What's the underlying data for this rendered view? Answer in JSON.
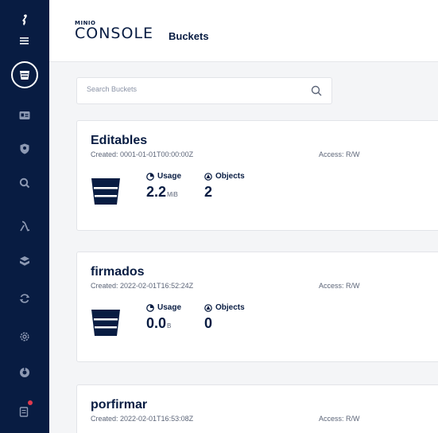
{
  "app": {
    "brand_top": "MINIO",
    "brand_main": "CONSOLE",
    "page_title": "Buckets"
  },
  "search": {
    "placeholder": "Search Buckets"
  },
  "sidebar": {
    "items": [
      {
        "icon": "menu-icon"
      },
      {
        "icon": "bucket-icon",
        "active": true
      },
      {
        "icon": "id-card-icon"
      },
      {
        "icon": "user-shield-icon"
      },
      {
        "icon": "search-icon"
      },
      {
        "icon": "lambda-icon"
      },
      {
        "icon": "tiers-icon"
      },
      {
        "icon": "sync-icon"
      },
      {
        "icon": "settings-icon"
      },
      {
        "icon": "support-icon"
      },
      {
        "icon": "license-icon",
        "badge": true
      }
    ]
  },
  "buckets": [
    {
      "name": "Editables",
      "created": "Created: 0001-01-01T00:00:00Z",
      "access": "Access: R/W",
      "usage_label": "Usage",
      "usage_value": "2.2",
      "usage_unit": "MiB",
      "objects_label": "Objects",
      "objects_value": "2"
    },
    {
      "name": "firmados",
      "created": "Created: 2022-02-01T16:52:24Z",
      "access": "Access: R/W",
      "usage_label": "Usage",
      "usage_value": "0.0",
      "usage_unit": "B",
      "objects_label": "Objects",
      "objects_value": "0"
    },
    {
      "name": "porfirmar",
      "created": "Created: 2022-02-01T16:53:08Z",
      "access": "Access: R/W"
    }
  ],
  "colors": {
    "sidebar_bg": "#081c42",
    "text_primary": "#081c42",
    "badge": "#e03a4e"
  }
}
